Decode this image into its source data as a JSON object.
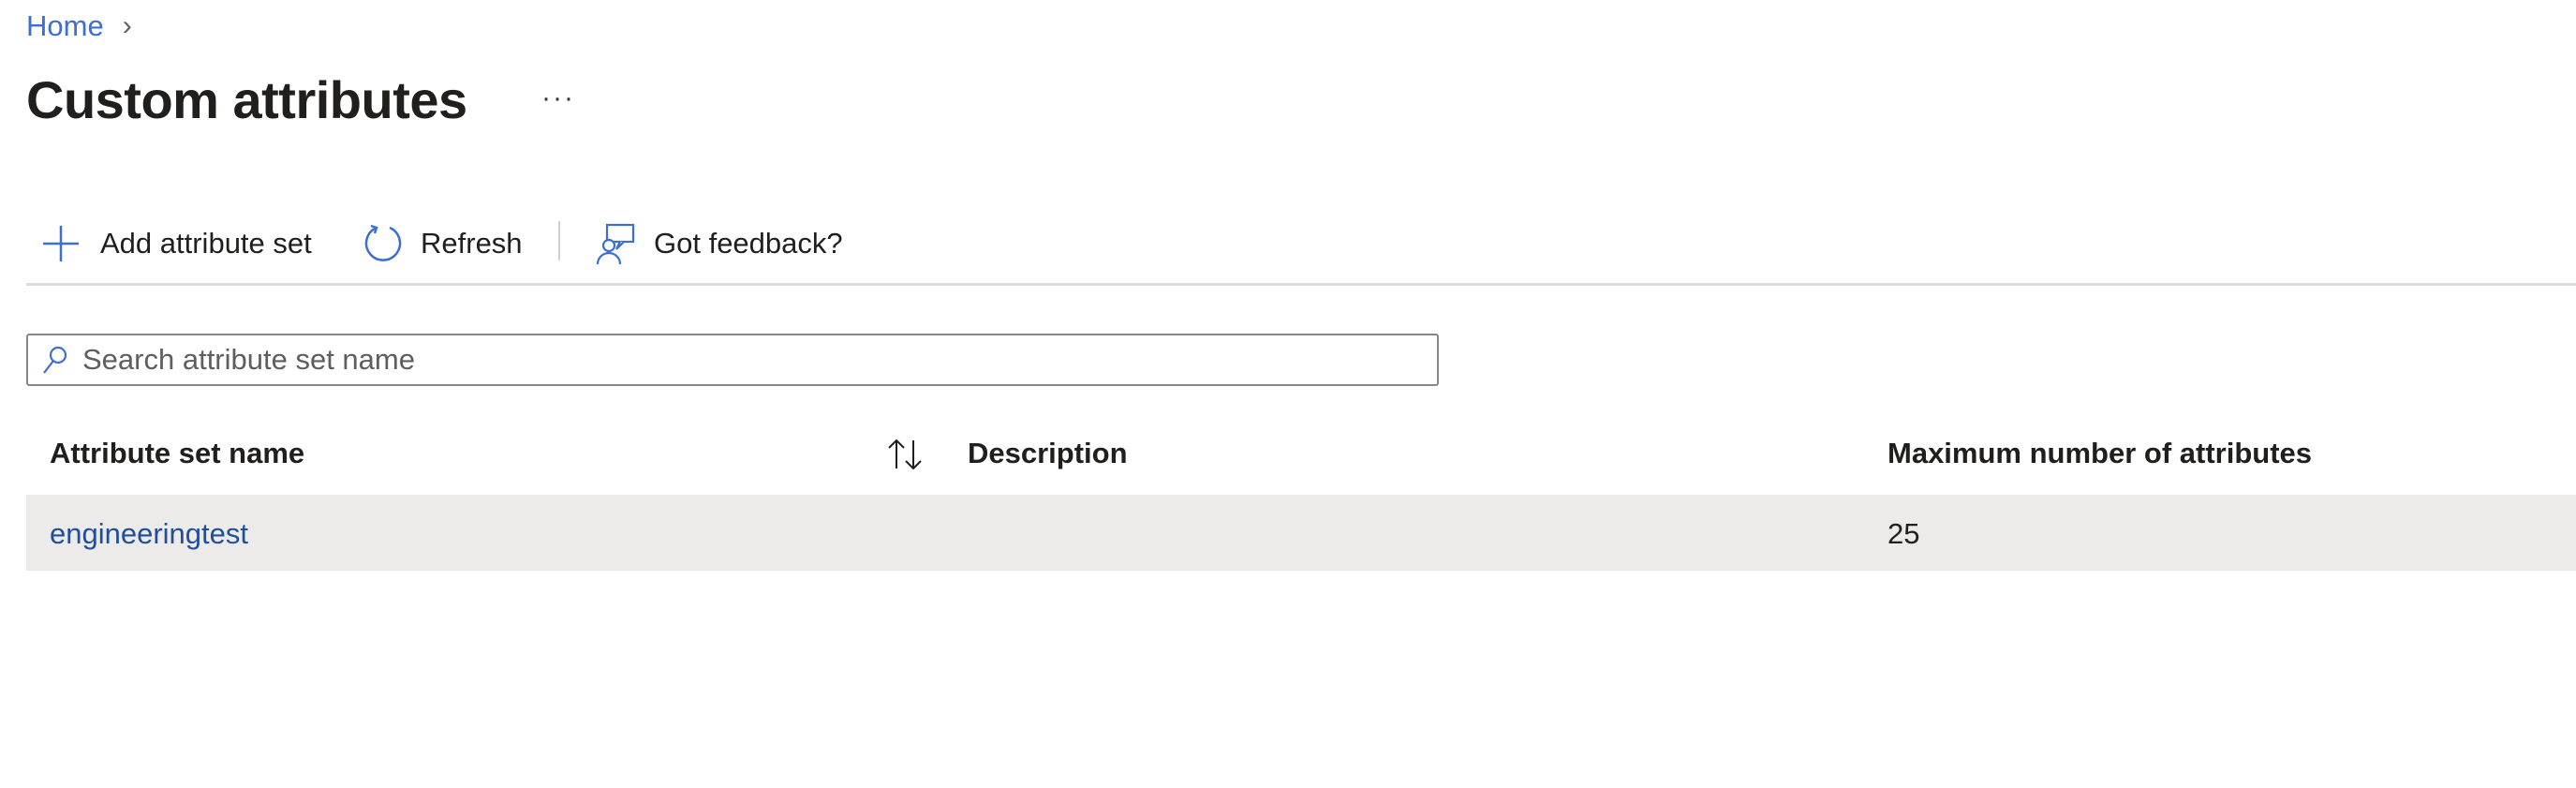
{
  "breadcrumb": {
    "items": [
      {
        "label": "Home"
      }
    ]
  },
  "page": {
    "title": "Custom attributes",
    "more_label": "···"
  },
  "toolbar": {
    "add_label": "Add attribute set",
    "refresh_label": "Refresh",
    "feedback_label": "Got feedback?"
  },
  "search": {
    "placeholder": "Search attribute set name",
    "value": ""
  },
  "table": {
    "columns": [
      "Attribute set name",
      "Description",
      "Maximum number of attributes"
    ],
    "rows": [
      {
        "name": "engineeringtest",
        "description": "",
        "max": "25"
      }
    ]
  },
  "colors": {
    "accent": "#3c6fd1",
    "link": "#1f4f9c",
    "row_selected": "#edebe9"
  }
}
